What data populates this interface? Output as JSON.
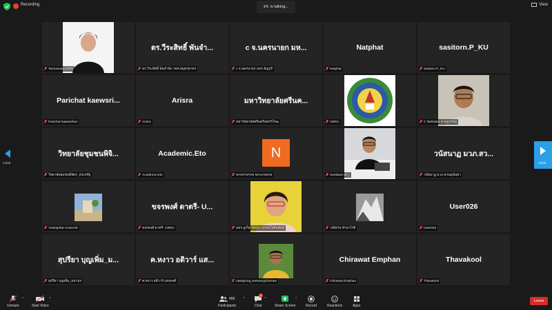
{
  "topbar": {
    "recording_label": "Recording",
    "talking_indicator": "ดร. is talking...",
    "view_label": "View"
  },
  "nav": {
    "left_page": "14/28",
    "right_page": "14/28"
  },
  "tiles": [
    {
      "name": "",
      "label": "Tamonwan.F.P.N"
    },
    {
      "name": "ดร.วีระสิทธิ์ พันจํา...",
      "label": "ดร.วีระสิทธิ์ พันจําจัด วชช.สมุทรสาคร"
    },
    {
      "name": "c จ.นครนายก มห...",
      "label": "c จ.นครนายก มหร.ธัญบุรี"
    },
    {
      "name": "Natphat",
      "label": "Natphat"
    },
    {
      "name": "sasitorn.P_KU",
      "label": "sasitorn.P_KU"
    },
    {
      "name": "Parichat kaewsri...",
      "label": "Parichat kaewsribut"
    },
    {
      "name": "Arisra",
      "label": "Arisra"
    },
    {
      "name": "มหาวิทยาลัยศรีนค...",
      "label": "มหาวิทยาลัยศรีนครินทรวิโรฒ"
    },
    {
      "name": "",
      "label": "UBRU"
    },
    {
      "name": "",
      "label": "C ชลธนดล สายสุวรรณ"
    },
    {
      "name": "วิทยาลัยชุมชนพิจิ...",
      "label": "วิทยาลัยชุมชนพิจิตร_ประหรัฐ"
    },
    {
      "name": "Academic.Eto",
      "label": "Academic.Eto"
    },
    {
      "name": "",
      "label": "NANTAPON MAHAWAN",
      "avatar_letter": "N"
    },
    {
      "name": "",
      "label": "Santiwat Ur..."
    },
    {
      "name": "วนัสนาฏ มวภ.สว...",
      "label": "วนัสนาฏ มวภ.สวนสุนันทา"
    },
    {
      "name": "",
      "label": "Yodsaphat Arsanork"
    },
    {
      "name": "ขจรพงศ์ ดาตรี- U...",
      "label": "ขจรพงศ์ ดาตรี- UBRU"
    },
    {
      "name": "",
      "label": "มหร.ภูเก็ต-ไตรภา ธรรมโยธินพันธ์"
    },
    {
      "name": "",
      "label": "วณิชวัน ทํานาไร่ธิ"
    },
    {
      "name": "User026",
      "label": "User026"
    },
    {
      "name": "สุปรียา บุญเพิ่ม_ม...",
      "label": "สุปรียา บุญเพิ่ม_มหวนก"
    },
    {
      "name": "ค.หงาว อดิวาร์ แส...",
      "label": "ค.หงาว อดิวาร์ แสงพงศ์"
    },
    {
      "name": "",
      "label": "nattapong yeewangcharoen"
    },
    {
      "name": "Chirawat Emphan",
      "label": "Chirawat Emphan"
    },
    {
      "name": "Thavakool",
      "label": "Thavakool"
    }
  ],
  "toolbar": {
    "unmute": "Unmute",
    "start_video": "Start Video",
    "participants": "Participants",
    "participants_count": "488",
    "chat": "Chat",
    "chat_badge": "3",
    "share_screen": "Share Screen",
    "record": "Record",
    "reactions": "Reactions",
    "apps": "Apps",
    "leave": "Leave"
  },
  "colors": {
    "accent": "#2aa0e8",
    "share_green": "#23c05b",
    "leave_red": "#d92b2b",
    "record_red": "#e8412c",
    "avatar_orange": "#f06a22"
  }
}
